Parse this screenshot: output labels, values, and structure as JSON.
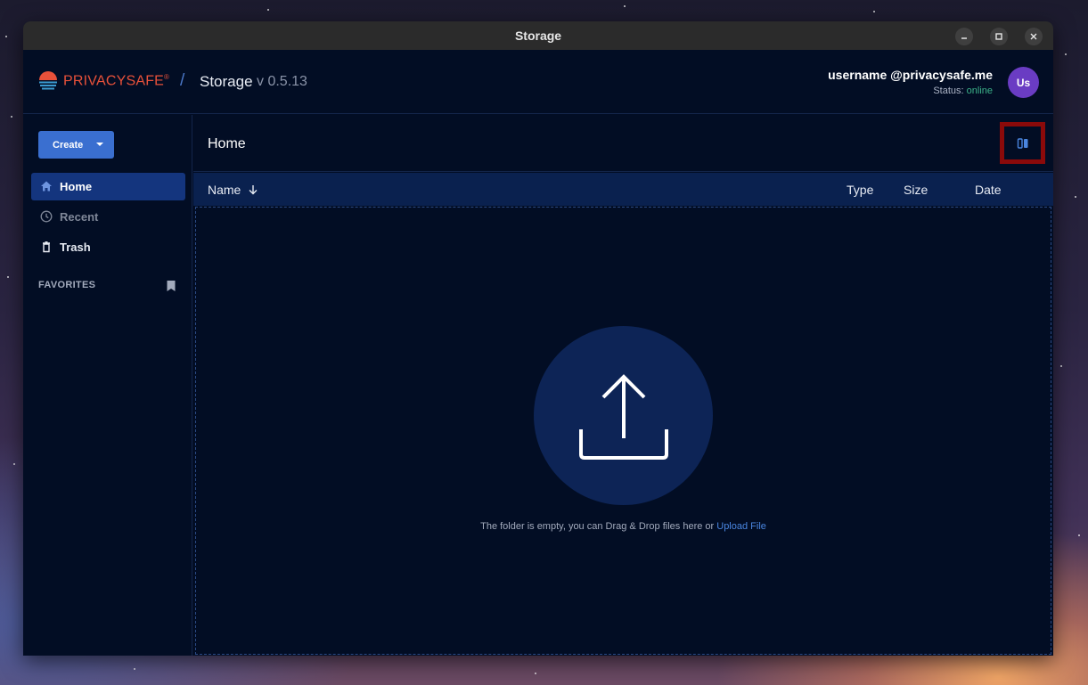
{
  "window": {
    "title": "Storage"
  },
  "header": {
    "brand": "PRIVACYSAFE",
    "brand_mark": "®",
    "separator": "/",
    "app_name": "Storage",
    "version": "v 0.5.13",
    "user_name": "username @privacysafe.me",
    "status_label": "Status:",
    "status_value": "online",
    "avatar_initials": "Us"
  },
  "sidebar": {
    "create_label": "Create",
    "items": [
      {
        "label": "Home",
        "icon": "home-icon"
      },
      {
        "label": "Recent",
        "icon": "clock-icon"
      },
      {
        "label": "Trash",
        "icon": "trash-icon"
      }
    ],
    "favorites_label": "FAVORITES"
  },
  "main": {
    "title": "Home",
    "columns": {
      "name": "Name",
      "type": "Type",
      "size": "Size",
      "date": "Date"
    },
    "empty_message": "The folder is empty, you can Drag & Drop files here or",
    "upload_link": "Upload File"
  },
  "colors": {
    "accent": "#3a6fd0",
    "brand": "#e8513a",
    "status_online": "#3cb38a",
    "avatar": "#6a3cc3",
    "highlight_border": "#8b0a0a"
  }
}
